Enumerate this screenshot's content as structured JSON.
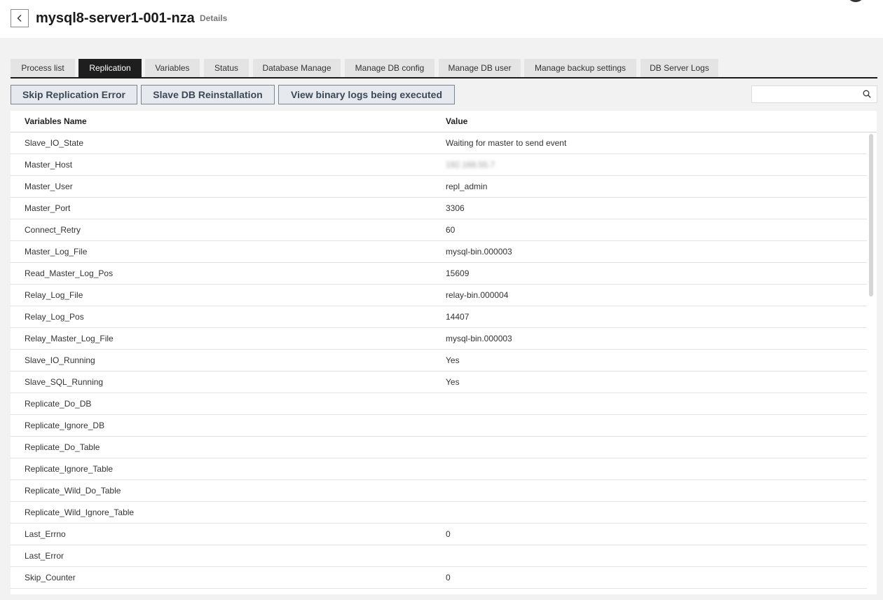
{
  "header": {
    "title": "mysql8-server1-001-nza",
    "subtitle": "Details",
    "back_icon": "chevron-left-icon"
  },
  "tabs": [
    {
      "label": "Process list",
      "active": false
    },
    {
      "label": "Replication",
      "active": true
    },
    {
      "label": "Variables",
      "active": false
    },
    {
      "label": "Status",
      "active": false
    },
    {
      "label": "Database Manage",
      "active": false
    },
    {
      "label": "Manage DB config",
      "active": false
    },
    {
      "label": "Manage DB user",
      "active": false
    },
    {
      "label": "Manage backup settings",
      "active": false
    },
    {
      "label": "DB Server Logs",
      "active": false
    }
  ],
  "actions": {
    "skip_error": "Skip Replication Error",
    "reinstall": "Slave DB Reinstallation",
    "binary_logs": "View binary logs being executed"
  },
  "search": {
    "placeholder": "",
    "value": "",
    "icon": "search-icon"
  },
  "table": {
    "columns": [
      "Variables Name",
      "Value"
    ],
    "rows": [
      {
        "name": "Slave_IO_State",
        "value": "Waiting for master to send event"
      },
      {
        "name": "Master_Host",
        "value": "192.168.55.7",
        "blurred": true
      },
      {
        "name": "Master_User",
        "value": "repl_admin"
      },
      {
        "name": "Master_Port",
        "value": "3306"
      },
      {
        "name": "Connect_Retry",
        "value": "60"
      },
      {
        "name": "Master_Log_File",
        "value": "mysql-bin.000003"
      },
      {
        "name": "Read_Master_Log_Pos",
        "value": "15609"
      },
      {
        "name": "Relay_Log_File",
        "value": "relay-bin.000004"
      },
      {
        "name": "Relay_Log_Pos",
        "value": "14407"
      },
      {
        "name": "Relay_Master_Log_File",
        "value": "mysql-bin.000003"
      },
      {
        "name": "Slave_IO_Running",
        "value": "Yes"
      },
      {
        "name": "Slave_SQL_Running",
        "value": "Yes"
      },
      {
        "name": "Replicate_Do_DB",
        "value": ""
      },
      {
        "name": "Replicate_Ignore_DB",
        "value": ""
      },
      {
        "name": "Replicate_Do_Table",
        "value": ""
      },
      {
        "name": "Replicate_Ignore_Table",
        "value": ""
      },
      {
        "name": "Replicate_Wild_Do_Table",
        "value": ""
      },
      {
        "name": "Replicate_Wild_Ignore_Table",
        "value": ""
      },
      {
        "name": "Last_Errno",
        "value": "0"
      },
      {
        "name": "Last_Error",
        "value": ""
      },
      {
        "name": "Skip_Counter",
        "value": "0"
      }
    ]
  },
  "colors": {
    "active_tab": "#1e1e1e",
    "button_border": "#7a8594",
    "button_text": "#3d4857"
  }
}
